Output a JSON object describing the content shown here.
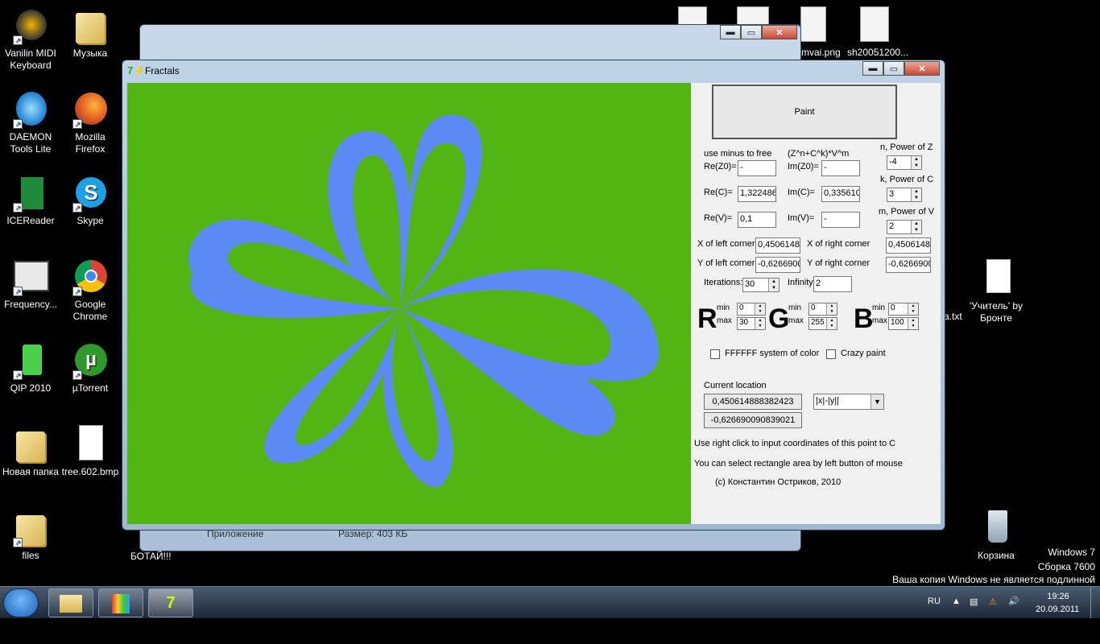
{
  "desktop": {
    "icons_left": [
      {
        "label": "Vanilin MIDI Keyboard",
        "icon": "midi-keyboard-icon"
      },
      {
        "label": "DAEMON Tools Lite",
        "icon": "daemon-tools-icon"
      },
      {
        "label": "ICEReader",
        "icon": "icereader-icon"
      },
      {
        "label": "Frequency...",
        "icon": "frequency-icon"
      },
      {
        "label": "QIP 2010",
        "icon": "qip-icon"
      },
      {
        "label": "Новая папка",
        "icon": "folder-icon"
      },
      {
        "label": "files",
        "icon": "folder-icon"
      }
    ],
    "icons_col2": [
      {
        "label": "Музыка",
        "icon": "folder-icon"
      },
      {
        "label": "Mozilla Firefox",
        "icon": "firefox-icon"
      },
      {
        "label": "Skype",
        "icon": "skype-icon"
      },
      {
        "label": "Google Chrome",
        "icon": "chrome-icon"
      },
      {
        "label": "µTorrent",
        "icon": "utorrent-icon"
      },
      {
        "label": "tree.602.bmp",
        "icon": "image-file-icon"
      }
    ],
    "top_files": [
      {
        "label": "mvai.png"
      },
      {
        "label": "sh20051200..."
      }
    ],
    "right_icons": [
      {
        "label": "'Учитель' by Бронте",
        "icon": "document-icon"
      },
      {
        "label": "Корзина",
        "icon": "recycle-bin-icon"
      }
    ],
    "partial_text": [
      "a.txt",
      "БОТАЙ!!!"
    ],
    "watermark": {
      "line1": "Windows 7",
      "line2": "Сборка 7600",
      "line3": "Ваша копия Windows не является подлинной"
    }
  },
  "window": {
    "title": "Fractals",
    "minimize": "▬",
    "maximize": "▭",
    "close": "✕"
  },
  "panel": {
    "paint_label": "Paint",
    "use_minus": "use minus to free",
    "formula": "(Z^n+C^k)*V^m",
    "n_label": "n, Power of Z",
    "n_value": "-4",
    "k_label": "k, Power of C",
    "k_value": "3",
    "m_label": "m, Power of V",
    "m_value": "2",
    "re_z0_label": "Re(Z0)=",
    "re_z0": "-",
    "im_z0_label": "Im(Z0)=",
    "im_z0": "-",
    "re_c_label": "Re(C)=",
    "re_c": "1,322486",
    "im_c_label": "Im(C)=",
    "im_c": "0,335610",
    "re_v_label": "Re(V)=",
    "re_v": "0,1",
    "im_v_label": "Im(V)=",
    "im_v": "-",
    "x_left_label": "X of left corner",
    "x_left": "0,4506148",
    "x_right_label": "X of right corner",
    "x_right": "0,4506148",
    "y_left_label": "Y of left corner",
    "y_left": "-0,6266900",
    "y_right_label": "Y of right corner",
    "y_right": "-0,6266900",
    "iter_label": "Iterations:",
    "iter": "30",
    "inf_label": "Infinity:",
    "inf": "2",
    "r": "R",
    "g": "G",
    "b": "B",
    "min": "min",
    "max": "max",
    "r_min": "0",
    "r_max": "30",
    "g_min": "0",
    "g_max": "255",
    "b_min": "0",
    "b_max": "100",
    "ffffff": "FFFFFF system of color",
    "crazy": "Crazy paint",
    "current_loc": "Current location",
    "loc_x": "0,450614888382423",
    "loc_y": "-0,626690090839021",
    "norm": "|x|-|y||",
    "hint1": "Use right click to input coordinates of this point to C",
    "hint2": "You can select rectangle area by left button of mouse",
    "copyright": "(c) Константин Остриков, 2010"
  },
  "bgwindow": {
    "partial1": "Приложение",
    "partial2": "Размер: 403 КБ"
  },
  "taskbar": {
    "lang": "RU",
    "time": "19:26",
    "date": "20.09.2011"
  },
  "colors": {
    "canvas_bg": "#53b514",
    "fractal": "#5b8af5"
  }
}
